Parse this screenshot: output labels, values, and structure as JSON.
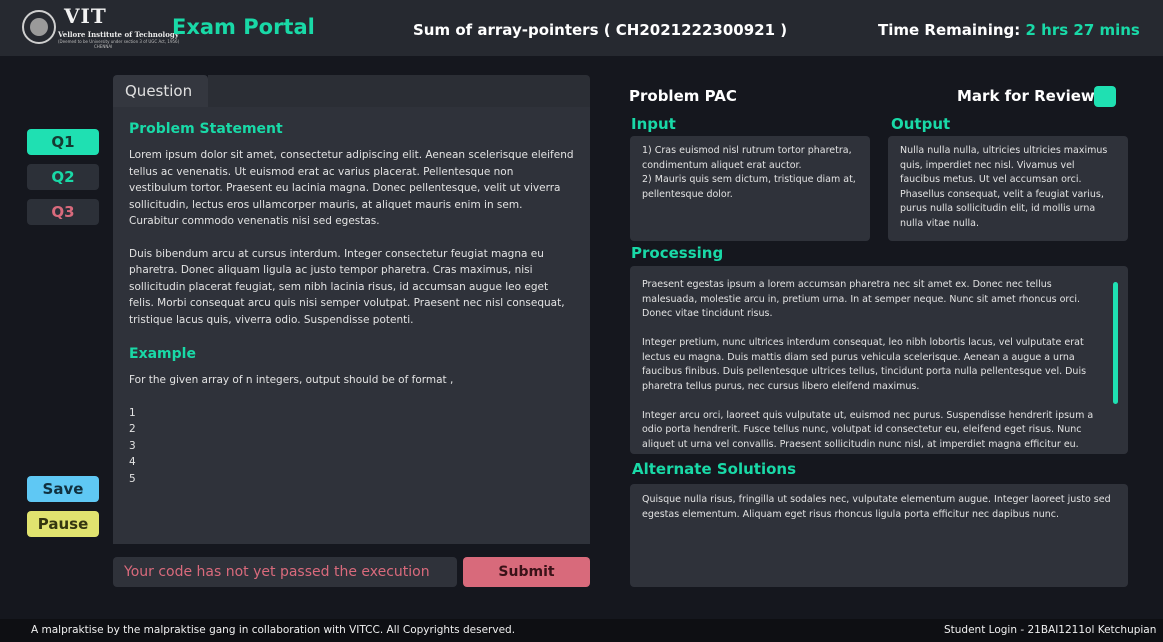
{
  "header": {
    "logo_text": "VIT",
    "logo_subtitle": "Vellore Institute of Technology",
    "logo_tagline": "(Deemed to be University under section 3 of UGC Act, 1956)",
    "logo_city": "CHENNAI",
    "app_title": "Exam Portal",
    "exam_title": "Sum of array-pointers ( CH2021222300921 )",
    "timer_label": "Time Remaining:",
    "timer_value": "2 hrs 27 mins"
  },
  "sidebar": {
    "questions": [
      {
        "label": "Q1",
        "active": true
      },
      {
        "label": "Q2",
        "active": false
      },
      {
        "label": "Q3",
        "active": false
      }
    ],
    "save_label": "Save",
    "pause_label": "Pause"
  },
  "question": {
    "tab_label": "Question",
    "problem_title": "Problem Statement",
    "paragraphs": [
      "Lorem ipsum dolor sit amet, consectetur adipiscing elit. Aenean scelerisque eleifend tellus ac venenatis. Ut euismod erat ac varius placerat. Pellentesque non vestibulum tortor. Praesent eu lacinia magna. Donec pellentesque, velit ut viverra sollicitudin, lectus eros ullamcorper mauris, at aliquet mauris enim in sem. Curabitur commodo venenatis nisi sed egestas.",
      "Duis bibendum arcu at cursus interdum. Integer consectetur feugiat magna eu pharetra. Donec aliquam ligula ac justo tempor pharetra. Cras maximus, nisi sollicitudin placerat feugiat, sem nibh lacinia risus, id accumsan augue leo eget felis. Morbi consequat arcu quis nisi semper volutpat. Praesent nec nisl consequat, tristique lacus quis, viverra odio. Suspendisse potenti."
    ],
    "example_title": "Example",
    "example_intro": "For the given array of n integers, output should be of format ,",
    "example_lines": [
      "1",
      "2",
      "3",
      "4",
      "5"
    ]
  },
  "status": {
    "message": "Your code has not yet passed the execution",
    "submit_label": "Submit"
  },
  "pac": {
    "title": "Problem PAC",
    "review_label": "Mark for Review:",
    "input_title": "Input",
    "input_lines": [
      "1) Cras euismod nisl rutrum tortor pharetra, condimentum aliquet erat auctor.",
      "2) Mauris quis sem dictum, tristique diam at, pellentesque dolor."
    ],
    "output_title": "Output",
    "output_text": "Nulla nulla nulla, ultricies ultricies maximus quis, imperdiet nec nisl. Vivamus vel faucibus metus. Ut vel accumsan orci. Phasellus consequat, velit a feugiat varius, purus nulla sollicitudin elit, id mollis urna nulla vitae nulla.",
    "processing_title": "Processing",
    "processing_paragraphs": [
      "Praesent egestas ipsum a lorem accumsan pharetra nec sit amet ex. Donec nec tellus malesuada, molestie arcu in, pretium urna. In at semper neque. Nunc sit amet rhoncus orci. Donec vitae tincidunt risus.",
      "Integer pretium, nunc ultrices interdum consequat, leo nibh lobortis lacus, vel vulputate erat lectus eu magna. Duis mattis diam sed purus vehicula scelerisque. Aenean a augue a urna faucibus finibus. Duis pellentesque ultrices tellus, tincidunt porta nulla pellentesque vel. Duis pharetra tellus purus, nec cursus libero eleifend maximus.",
      "Integer arcu orci, laoreet quis vulputate ut, euismod nec purus. Suspendisse hendrerit ipsum a odio porta hendrerit. Fusce tellus nunc, volutpat id consectetur eu, eleifend eget risus. Nunc aliquet ut urna vel convallis. Praesent sollicitudin nunc nisl, at imperdiet magna efficitur eu."
    ],
    "alt_title": "Alternate Solutions",
    "alt_text": "Quisque nulla risus, fringilla ut sodales nec, vulputate elementum augue. Integer laoreet justo sed egestas elementum. Aliquam eget risus rhoncus ligula porta efficitur nec dapibus nunc."
  },
  "footer": {
    "left_text": "A malpraktise by the malpraktise gang in collaboration with VITCC. All Copyrights deserved.",
    "right_text": "Student Login - 21BAI1211ol Ketchupian"
  },
  "colors": {
    "accent": "#19d9a7",
    "danger": "#d86a7b",
    "save": "#5fc8f4",
    "pause": "#e1e36f",
    "background": "#15171e",
    "panel": "#2f323a"
  }
}
